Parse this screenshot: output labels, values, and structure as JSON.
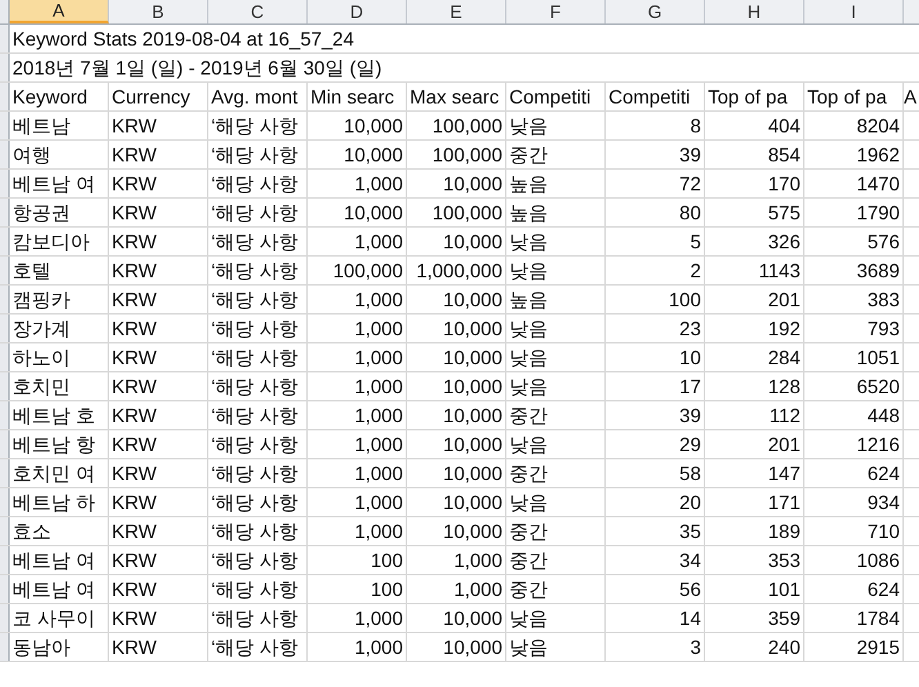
{
  "column_headers": [
    {
      "label": "A",
      "selected": true
    },
    {
      "label": "B",
      "selected": false
    },
    {
      "label": "C",
      "selected": false
    },
    {
      "label": "D",
      "selected": false
    },
    {
      "label": "E",
      "selected": false
    },
    {
      "label": "F",
      "selected": false
    },
    {
      "label": "G",
      "selected": false
    },
    {
      "label": "H",
      "selected": false
    },
    {
      "label": "I",
      "selected": false
    }
  ],
  "title": "Keyword Stats 2019-08-04 at 16_57_24",
  "date_range": "2018년 7월 1일 (일) - 2019년 6월 30일 (일)",
  "table": {
    "columns": [
      "Keyword",
      "Currency",
      "Avg. mont",
      "Min searc",
      "Max searc",
      "Competiti",
      "Competiti",
      "Top of pa",
      "Top of pa",
      "A"
    ],
    "rows": [
      [
        "베트남",
        "KRW",
        "‘해당 사항",
        "10,000",
        "100,000",
        "낮음",
        "8",
        "404",
        "8204"
      ],
      [
        "여행",
        "KRW",
        "‘해당 사항",
        "10,000",
        "100,000",
        "중간",
        "39",
        "854",
        "1962"
      ],
      [
        "베트남 여",
        "KRW",
        "‘해당 사항",
        "1,000",
        "10,000",
        "높음",
        "72",
        "170",
        "1470"
      ],
      [
        "항공권",
        "KRW",
        "‘해당 사항",
        "10,000",
        "100,000",
        "높음",
        "80",
        "575",
        "1790"
      ],
      [
        "캄보디아",
        "KRW",
        "‘해당 사항",
        "1,000",
        "10,000",
        "낮음",
        "5",
        "326",
        "576"
      ],
      [
        "호텔",
        "KRW",
        "‘해당 사항",
        "100,000",
        "1,000,000",
        "낮음",
        "2",
        "1143",
        "3689"
      ],
      [
        "캠핑카",
        "KRW",
        "‘해당 사항",
        "1,000",
        "10,000",
        "높음",
        "100",
        "201",
        "383"
      ],
      [
        "장가계",
        "KRW",
        "‘해당 사항",
        "1,000",
        "10,000",
        "낮음",
        "23",
        "192",
        "793"
      ],
      [
        "하노이",
        "KRW",
        "‘해당 사항",
        "1,000",
        "10,000",
        "낮음",
        "10",
        "284",
        "1051"
      ],
      [
        "호치민",
        "KRW",
        "‘해당 사항",
        "1,000",
        "10,000",
        "낮음",
        "17",
        "128",
        "6520"
      ],
      [
        "베트남 호",
        "KRW",
        "‘해당 사항",
        "1,000",
        "10,000",
        "중간",
        "39",
        "112",
        "448"
      ],
      [
        "베트남 항",
        "KRW",
        "‘해당 사항",
        "1,000",
        "10,000",
        "낮음",
        "29",
        "201",
        "1216"
      ],
      [
        "호치민 여",
        "KRW",
        "‘해당 사항",
        "1,000",
        "10,000",
        "중간",
        "58",
        "147",
        "624"
      ],
      [
        "베트남 하",
        "KRW",
        "‘해당 사항",
        "1,000",
        "10,000",
        "낮음",
        "20",
        "171",
        "934"
      ],
      [
        "효소",
        "KRW",
        "‘해당 사항",
        "1,000",
        "10,000",
        "중간",
        "35",
        "189",
        "710"
      ],
      [
        "베트남 여",
        "KRW",
        "‘해당 사항",
        "100",
        "1,000",
        "중간",
        "34",
        "353",
        "1086"
      ],
      [
        "베트남 여",
        "KRW",
        "‘해당 사항",
        "100",
        "1,000",
        "중간",
        "56",
        "101",
        "624"
      ],
      [
        "코 사무이",
        "KRW",
        "‘해당 사항",
        "1,000",
        "10,000",
        "낮음",
        "14",
        "359",
        "1784"
      ],
      [
        "동남아",
        "KRW",
        "‘해당 사항",
        "1,000",
        "10,000",
        "낮음",
        "3",
        "240",
        "2915"
      ]
    ]
  }
}
